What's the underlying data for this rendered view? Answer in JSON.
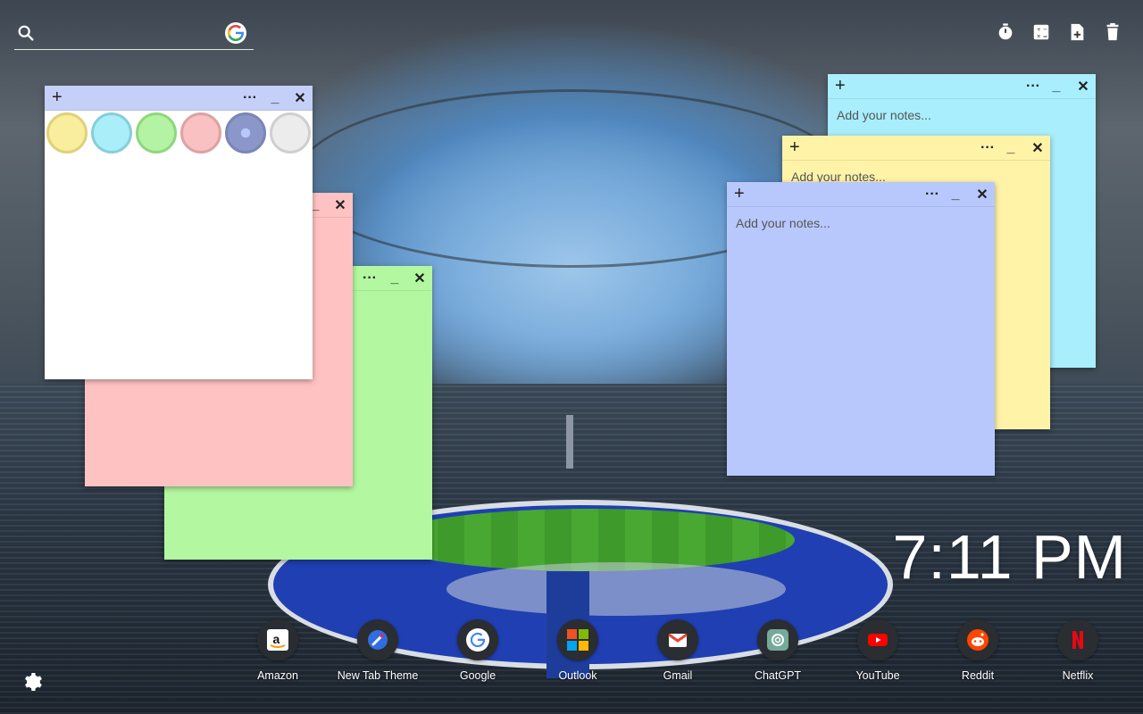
{
  "search": {
    "placeholder": ""
  },
  "tools": [
    {
      "name": "timer-icon"
    },
    {
      "name": "calculator-icon"
    },
    {
      "name": "new-note-icon"
    },
    {
      "name": "trash-icon"
    }
  ],
  "notes": {
    "placeholder": "Add your notes...",
    "colors": {
      "white": "#ffffff",
      "pink": "#ffc2c2",
      "green": "#b3f8a0",
      "cyan": "#a8eefc",
      "yellow": "#fff3a8",
      "blue": "#b8c8fd",
      "header_blue": "#c5d0f9"
    },
    "palette": [
      "#f8ee9e",
      "#a9eef8",
      "#b4f2a4",
      "#f9c1c1",
      "#8b97c8",
      "#e7e7e7"
    ]
  },
  "clock": {
    "time": "7:11 PM"
  },
  "dock": [
    {
      "label": "Amazon"
    },
    {
      "label": "New Tab Theme"
    },
    {
      "label": "Google"
    },
    {
      "label": "Outlook"
    },
    {
      "label": "Gmail"
    },
    {
      "label": "ChatGPT"
    },
    {
      "label": "YouTube"
    },
    {
      "label": "Reddit"
    },
    {
      "label": "Netflix"
    }
  ]
}
